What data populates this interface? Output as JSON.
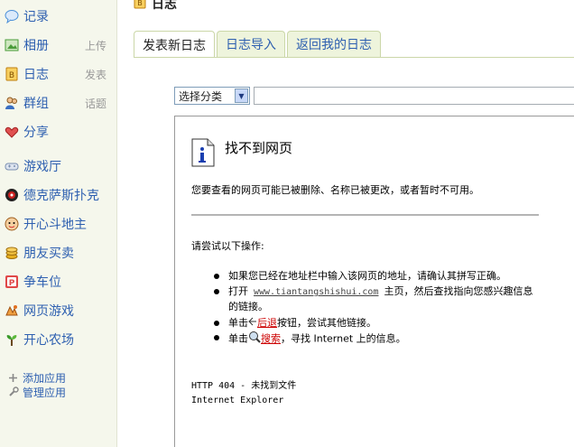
{
  "sidebar": {
    "items": [
      {
        "label": "记录",
        "extra": "",
        "icon": "speech-bubble-icon",
        "color": "#4a8fd8"
      },
      {
        "label": "相册",
        "extra": "上传",
        "icon": "photo-icon",
        "color": "#4a9c3a"
      },
      {
        "label": "日志",
        "extra": "发表",
        "icon": "journal-icon",
        "color": "#e0a020"
      },
      {
        "label": "群组",
        "extra": "话题",
        "icon": "group-icon",
        "color": "#3b6fc2"
      },
      {
        "label": "分享",
        "extra": "",
        "icon": "heart-icon",
        "color": "#d84040"
      },
      {
        "label": "游戏厅",
        "extra": "",
        "icon": "gamepad-icon",
        "color": "#7a8fb0"
      },
      {
        "label": "德克萨斯扑克",
        "extra": "",
        "icon": "poker-icon",
        "color": "#cc2222"
      },
      {
        "label": "开心斗地主",
        "extra": "",
        "icon": "cards-icon",
        "color": "#d83030"
      },
      {
        "label": "朋友买卖",
        "extra": "",
        "icon": "coins-icon",
        "color": "#e8b020"
      },
      {
        "label": "争车位",
        "extra": "",
        "icon": "parking-icon",
        "color": "#d84040"
      },
      {
        "label": "网页游戏",
        "extra": "",
        "icon": "web-game-icon",
        "color": "#e07020"
      },
      {
        "label": "开心农场",
        "extra": "",
        "icon": "sprout-icon",
        "color": "#3a9a2a"
      }
    ],
    "apps": [
      {
        "label": "添加应用",
        "icon": "add-app-icon"
      },
      {
        "label": "管理应用",
        "icon": "wrench-icon"
      }
    ]
  },
  "header": {
    "title": "日志"
  },
  "tabs": [
    {
      "label": "发表新日志",
      "active": true
    },
    {
      "label": "日志导入",
      "active": false
    },
    {
      "label": "返回我的日志",
      "active": false
    }
  ],
  "category_select": {
    "value": "选择分类"
  },
  "error_page": {
    "title": "找不到网页",
    "description": "您要查看的网页可能已被删除、名称已被更改，或者暂时不可用。",
    "try_heading": "请尝试以下操作:",
    "bullet1": "如果您已经在地址栏中输入该网页的地址，请确认其拼写正确。",
    "bullet2_prefix": "打开",
    "bullet2_url": "www.tiantangshishui.com",
    "bullet2_suffix": "主页，然后查找指向您感兴趣信息的链接。",
    "bullet3_prefix": "单击",
    "bullet3_link": "后退",
    "bullet3_suffix": "按钮，尝试其他链接。",
    "bullet4_prefix": "单击",
    "bullet4_link": "搜索",
    "bullet4_suffix": "，寻找 Internet 上的信息。",
    "footer_line1": "HTTP 404 - 未找到文件",
    "footer_line2": "Internet Explorer"
  },
  "colors": {
    "link": "#2d5fb0",
    "tab_bg": "#eef4dc",
    "sidebar_bg": "#f5f7ec",
    "error_link": "#cc0000"
  }
}
